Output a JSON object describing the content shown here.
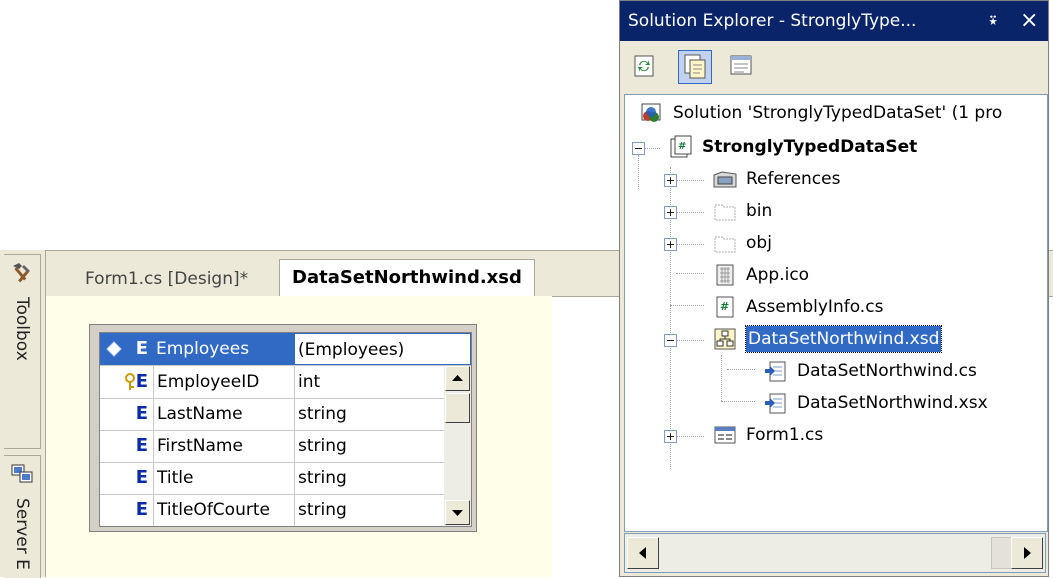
{
  "left_strip": {
    "toolbox_label": "Toolbox",
    "server_label": "Server E"
  },
  "tabs": {
    "form1": "Form1.cs [Design]*",
    "xsd": "DataSetNorthwind.xsd"
  },
  "element": {
    "header": {
      "glyph": "E",
      "name": "Employees",
      "type": "(Employees)"
    },
    "rows": [
      {
        "glyph": "E",
        "name": "EmployeeID",
        "type": "int",
        "key": true
      },
      {
        "glyph": "E",
        "name": "LastName",
        "type": "string",
        "key": false
      },
      {
        "glyph": "E",
        "name": "FirstName",
        "type": "string",
        "key": false
      },
      {
        "glyph": "E",
        "name": "Title",
        "type": "string",
        "key": false
      },
      {
        "glyph": "E",
        "name": "TitleOfCourte",
        "type": "string",
        "key": false
      }
    ]
  },
  "solution_explorer": {
    "title": "Solution Explorer - StronglyType...",
    "pin_glyph": "⍣",
    "close_glyph": "×",
    "tree": {
      "solution": "Solution 'StronglyTypedDataSet' (1 pro",
      "project": "StronglyTypedDataSet",
      "references": "References",
      "bin": "bin",
      "obj": "obj",
      "app_ico": "App.ico",
      "assembly_info": "AssemblyInfo.cs",
      "xsd": "DataSetNorthwind.xsd",
      "xsd_cs": "DataSetNorthwind.cs",
      "xsd_xsx": "DataSetNorthwind.xsx",
      "form1": "Form1.cs"
    }
  },
  "colors": {
    "selection": "#316ac5",
    "title_bar": "#0a246a",
    "chrome": "#ece9d8",
    "designer_bg": "#ffffe9"
  }
}
